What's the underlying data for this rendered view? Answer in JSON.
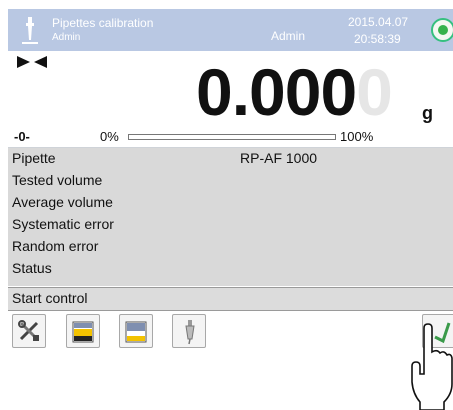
{
  "topbar": {
    "title": "Pipettes calibration",
    "subtitle": "Admin",
    "unit_label": "Admin",
    "date": "2015.04.07",
    "time": "20:58:39",
    "accent_color": "#b9c8e3",
    "status_color": "#36b24c",
    "status_icon": "status-led-icon"
  },
  "weighing": {
    "reading": "0.000",
    "ghost_digit": "0",
    "unit": "g",
    "zero_indicator": "-0-",
    "bar_min_label": "0%",
    "bar_max_label": "100%",
    "load_fraction": 0.0,
    "stable_icon": "stability-marker-icon"
  },
  "info": {
    "rows": [
      {
        "label": "Pipette",
        "value": "RP-AF 1000"
      },
      {
        "label": "Tested volume",
        "value": ""
      },
      {
        "label": "Average volume",
        "value": ""
      },
      {
        "label": "Systematic error",
        "value": ""
      },
      {
        "label": "Random error",
        "value": ""
      },
      {
        "label": "Status",
        "value": ""
      }
    ]
  },
  "start_control": {
    "label": "Start control"
  },
  "toolbar": {
    "buttons": [
      {
        "icon": "tools-icon"
      },
      {
        "icon": "print-header-icon"
      },
      {
        "icon": "print-footer-icon"
      },
      {
        "icon": "pipette-icon"
      },
      {
        "icon": "confirm-check-icon"
      }
    ]
  }
}
